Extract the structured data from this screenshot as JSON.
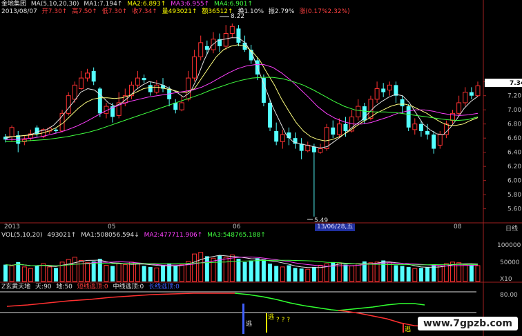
{
  "header": {
    "title": "金地集团",
    "ma_params": "MA(5,10,20,30)",
    "ma1": "MA1:7.194↑",
    "ma2": "MA2:6.893↑",
    "ma3": "MA3:6.955↑",
    "ma4": "MA4:6.901↑",
    "date": "2013/08/07",
    "open": "开7.30↑",
    "high": "高7.50↑",
    "low": "低7.30↑",
    "close": "收7.34↑",
    "volume": "量493021↑",
    "amount": "额36512↑",
    "turnover": "换1.10%",
    "amplitude": "振2.79%",
    "change": "涨(0.17%2.32%)"
  },
  "price_axis": {
    "ticks": [
      "7.40",
      "7.20",
      "7.00",
      "6.80",
      "6.60",
      "6.40",
      "6.20",
      "6.00",
      "5.80",
      "5.60"
    ],
    "current_label": "7.34",
    "high_marker": "8.22",
    "low_marker": "5.49"
  },
  "time_axis": {
    "labels": [
      "2013",
      "05",
      "06",
      "08"
    ],
    "cursor_label": "13/06/28,五",
    "right_label": "日线"
  },
  "volume_pane": {
    "header": "VOL(5,10,20)",
    "vol": "493021↑",
    "ma1": "MA1:508056.594↓",
    "ma2": "MA2:477711.906↑",
    "ma3": "MA3:548765.188↑",
    "ticks": [
      "100000",
      "50000"
    ],
    "unit": "X10"
  },
  "indicator_pane": {
    "header": "Z玄黄天地",
    "tian": "天:90",
    "di": "地:50",
    "short_escape": "短线逃顶:0",
    "mid_escape": "中线逃顶:0",
    "long_escape": "长线逃顶:0",
    "tick": "80.00",
    "signal_escape": "逃",
    "signal_q": "? ? ?"
  },
  "watermark": "www.7gpzb.com",
  "chart_data": {
    "type": "candlestick",
    "ylim": [
      5.45,
      8.3
    ],
    "candles": [
      {
        "o": 6.62,
        "c": 6.58,
        "h": 6.66,
        "l": 6.54
      },
      {
        "o": 6.62,
        "c": 6.75,
        "h": 6.78,
        "l": 6.55
      },
      {
        "o": 6.64,
        "c": 6.52,
        "h": 6.7,
        "l": 6.4
      },
      {
        "o": 6.55,
        "c": 6.58,
        "h": 6.63,
        "l": 6.5
      },
      {
        "o": 6.6,
        "c": 6.66,
        "h": 6.72,
        "l": 6.56
      },
      {
        "o": 6.75,
        "c": 6.66,
        "h": 6.78,
        "l": 6.62
      },
      {
        "o": 6.62,
        "c": 6.72,
        "h": 6.74,
        "l": 6.6
      },
      {
        "o": 6.7,
        "c": 6.74,
        "h": 6.76,
        "l": 6.66
      },
      {
        "o": 6.72,
        "c": 6.7,
        "h": 6.74,
        "l": 6.67
      },
      {
        "o": 6.7,
        "c": 6.95,
        "h": 7.0,
        "l": 6.68
      },
      {
        "o": 6.95,
        "c": 7.2,
        "h": 7.25,
        "l": 6.92
      },
      {
        "o": 7.15,
        "c": 7.35,
        "h": 7.4,
        "l": 7.1
      },
      {
        "o": 7.3,
        "c": 7.45,
        "h": 7.55,
        "l": 7.28
      },
      {
        "o": 7.45,
        "c": 7.52,
        "h": 7.58,
        "l": 7.4
      },
      {
        "o": 7.55,
        "c": 7.4,
        "h": 7.6,
        "l": 7.35
      },
      {
        "o": 7.3,
        "c": 6.95,
        "h": 7.32,
        "l": 6.9
      },
      {
        "o": 6.95,
        "c": 7.05,
        "h": 7.1,
        "l": 6.88
      },
      {
        "o": 7.05,
        "c": 6.9,
        "h": 7.1,
        "l": 6.82
      },
      {
        "o": 6.92,
        "c": 7.1,
        "h": 7.25,
        "l": 6.88
      },
      {
        "o": 7.1,
        "c": 7.2,
        "h": 7.3,
        "l": 7.05
      },
      {
        "o": 7.2,
        "c": 7.35,
        "h": 7.4,
        "l": 7.15
      },
      {
        "o": 7.35,
        "c": 7.45,
        "h": 7.55,
        "l": 7.3
      },
      {
        "o": 7.45,
        "c": 7.42,
        "h": 7.5,
        "l": 7.38
      },
      {
        "o": 7.35,
        "c": 7.25,
        "h": 7.4,
        "l": 7.2
      },
      {
        "o": 7.25,
        "c": 7.35,
        "h": 7.42,
        "l": 7.22
      },
      {
        "o": 7.35,
        "c": 7.3,
        "h": 7.45,
        "l": 7.25
      },
      {
        "o": 7.3,
        "c": 7.15,
        "h": 7.33,
        "l": 7.05
      },
      {
        "o": 7.1,
        "c": 7.0,
        "h": 7.15,
        "l": 6.95
      },
      {
        "o": 7.0,
        "c": 7.1,
        "h": 7.2,
        "l": 6.98
      },
      {
        "o": 7.15,
        "c": 7.45,
        "h": 7.55,
        "l": 7.12
      },
      {
        "o": 7.45,
        "c": 7.75,
        "h": 7.85,
        "l": 7.4
      },
      {
        "o": 7.75,
        "c": 7.95,
        "h": 8.05,
        "l": 7.7
      },
      {
        "o": 7.9,
        "c": 7.85,
        "h": 7.98,
        "l": 7.78
      },
      {
        "o": 7.85,
        "c": 8.0,
        "h": 8.1,
        "l": 7.8
      },
      {
        "o": 8.0,
        "c": 7.9,
        "h": 8.08,
        "l": 7.82
      },
      {
        "o": 7.9,
        "c": 8.08,
        "h": 8.2,
        "l": 7.85
      },
      {
        "o": 8.08,
        "c": 8.18,
        "h": 8.22,
        "l": 8.02
      },
      {
        "o": 8.15,
        "c": 7.95,
        "h": 8.2,
        "l": 7.9
      },
      {
        "o": 7.95,
        "c": 7.85,
        "h": 8.05,
        "l": 7.82
      },
      {
        "o": 7.85,
        "c": 7.7,
        "h": 7.92,
        "l": 7.65
      },
      {
        "o": 7.7,
        "c": 7.5,
        "h": 7.75,
        "l": 7.42
      },
      {
        "o": 7.45,
        "c": 7.1,
        "h": 7.5,
        "l": 7.05
      },
      {
        "o": 7.1,
        "c": 6.75,
        "h": 7.15,
        "l": 6.7
      },
      {
        "o": 6.7,
        "c": 6.55,
        "h": 6.82,
        "l": 6.5
      },
      {
        "o": 6.55,
        "c": 6.65,
        "h": 6.72,
        "l": 6.45
      },
      {
        "o": 6.68,
        "c": 6.6,
        "h": 6.75,
        "l": 6.5
      },
      {
        "o": 6.6,
        "c": 6.52,
        "h": 6.68,
        "l": 6.45
      },
      {
        "o": 6.52,
        "c": 6.42,
        "h": 6.6,
        "l": 6.3
      },
      {
        "o": 6.42,
        "c": 6.5,
        "h": 6.55,
        "l": 6.4
      },
      {
        "o": 6.48,
        "c": 6.4,
        "h": 6.52,
        "l": 5.49
      },
      {
        "o": 6.4,
        "c": 6.45,
        "h": 6.52,
        "l": 6.38
      },
      {
        "o": 6.45,
        "c": 6.75,
        "h": 6.8,
        "l": 6.42
      },
      {
        "o": 6.75,
        "c": 6.65,
        "h": 6.85,
        "l": 6.6
      },
      {
        "o": 6.65,
        "c": 6.8,
        "h": 6.88,
        "l": 6.6
      },
      {
        "o": 6.8,
        "c": 6.7,
        "h": 6.9,
        "l": 6.62
      },
      {
        "o": 6.7,
        "c": 6.9,
        "h": 7.0,
        "l": 6.68
      },
      {
        "o": 6.9,
        "c": 7.05,
        "h": 7.15,
        "l": 6.85
      },
      {
        "o": 7.05,
        "c": 6.85,
        "h": 7.1,
        "l": 6.8
      },
      {
        "o": 6.88,
        "c": 7.15,
        "h": 7.2,
        "l": 6.85
      },
      {
        "o": 7.15,
        "c": 7.3,
        "h": 7.4,
        "l": 7.1
      },
      {
        "o": 7.3,
        "c": 7.25,
        "h": 7.38,
        "l": 7.18
      },
      {
        "o": 7.28,
        "c": 7.35,
        "h": 7.4,
        "l": 7.2
      },
      {
        "o": 7.35,
        "c": 7.2,
        "h": 7.4,
        "l": 7.1
      },
      {
        "o": 7.15,
        "c": 7.05,
        "h": 7.2,
        "l": 6.95
      },
      {
        "o": 7.05,
        "c": 6.75,
        "h": 7.08,
        "l": 6.7
      },
      {
        "o": 6.72,
        "c": 6.8,
        "h": 6.88,
        "l": 6.65
      },
      {
        "o": 6.8,
        "c": 6.7,
        "h": 6.85,
        "l": 6.62
      },
      {
        "o": 6.7,
        "c": 6.65,
        "h": 6.8,
        "l": 6.58
      },
      {
        "o": 6.65,
        "c": 6.45,
        "h": 6.7,
        "l": 6.38
      },
      {
        "o": 6.5,
        "c": 6.65,
        "h": 6.7,
        "l": 6.45
      },
      {
        "o": 6.65,
        "c": 6.8,
        "h": 6.85,
        "l": 6.6
      },
      {
        "o": 6.85,
        "c": 6.95,
        "h": 7.0,
        "l": 6.8
      },
      {
        "o": 6.95,
        "c": 7.1,
        "h": 7.2,
        "l": 6.9
      },
      {
        "o": 7.1,
        "c": 7.25,
        "h": 7.32,
        "l": 7.05
      },
      {
        "o": 7.25,
        "c": 7.2,
        "h": 7.32,
        "l": 7.15
      },
      {
        "o": 7.2,
        "c": 7.34,
        "h": 7.4,
        "l": 7.18
      }
    ],
    "ma_series": [
      {
        "name": "MA1",
        "color": "#e0e0e0",
        "values": [
          6.6,
          6.62,
          6.63,
          6.64,
          6.66,
          6.7,
          6.72,
          6.78,
          6.88,
          7.0,
          7.12,
          7.25,
          7.3,
          7.28,
          7.2,
          7.1,
          7.05,
          7.1,
          7.18,
          7.28,
          7.35,
          7.4,
          7.38,
          7.35,
          7.3,
          7.25,
          7.18,
          7.25,
          7.45,
          7.7,
          7.9,
          7.98,
          8.0,
          8.02,
          8.02,
          7.95,
          7.8,
          7.55,
          7.3,
          7.05,
          6.85,
          6.65,
          6.55,
          6.52,
          6.5,
          6.48,
          6.46,
          6.48,
          6.55,
          6.62,
          6.7,
          6.78,
          6.85,
          6.95,
          7.05,
          7.12,
          7.18,
          7.22,
          7.2,
          7.1,
          6.95,
          6.8,
          6.72,
          6.66,
          6.65,
          6.75,
          6.88,
          7.02,
          7.12,
          7.19
        ]
      },
      {
        "name": "MA2",
        "color": "#ffff80",
        "values": [
          6.62,
          6.62,
          6.63,
          6.64,
          6.65,
          6.67,
          6.7,
          6.75,
          6.82,
          6.92,
          7.02,
          7.1,
          7.15,
          7.17,
          7.17,
          7.16,
          7.17,
          7.2,
          7.25,
          7.3,
          7.32,
          7.32,
          7.3,
          7.28,
          7.25,
          7.25,
          7.3,
          7.45,
          7.6,
          7.75,
          7.85,
          7.9,
          7.92,
          7.9,
          7.82,
          7.7,
          7.52,
          7.35,
          7.15,
          6.98,
          6.82,
          6.7,
          6.62,
          6.58,
          6.56,
          6.58,
          6.62,
          6.68,
          6.75,
          6.82,
          6.88,
          6.95,
          7.0,
          7.05,
          7.08,
          7.08,
          7.05,
          7.0,
          6.95,
          6.88,
          6.82,
          6.78,
          6.78,
          6.8,
          6.85,
          6.89
        ]
      },
      {
        "name": "MA3",
        "color": "#ff40ff",
        "values": [
          6.58,
          6.58,
          6.59,
          6.6,
          6.62,
          6.65,
          6.68,
          6.72,
          6.77,
          6.83,
          6.9,
          6.97,
          7.03,
          7.08,
          7.12,
          7.15,
          7.18,
          7.2,
          7.22,
          7.24,
          7.26,
          7.28,
          7.32,
          7.38,
          7.45,
          7.52,
          7.58,
          7.62,
          7.64,
          7.64,
          7.6,
          7.52,
          7.42,
          7.3,
          7.18,
          7.05,
          6.95,
          6.88,
          6.83,
          6.8,
          6.8,
          6.82,
          6.86,
          6.9,
          6.95,
          6.98,
          7.0,
          7.0,
          6.98,
          6.95,
          6.93,
          6.92,
          6.93,
          6.95
        ]
      },
      {
        "name": "MA4",
        "color": "#40ff40",
        "values": [
          6.55,
          6.55,
          6.56,
          6.57,
          6.58,
          6.6,
          6.62,
          6.65,
          6.68,
          6.72,
          6.77,
          6.82,
          6.87,
          6.92,
          6.97,
          7.02,
          7.07,
          7.12,
          7.17,
          7.22,
          7.28,
          7.33,
          7.38,
          7.42,
          7.45,
          7.46,
          7.46,
          7.44,
          7.4,
          7.35,
          7.28,
          7.2,
          7.12,
          7.05,
          7.0,
          6.98,
          6.97,
          6.97,
          6.96,
          6.94,
          6.92,
          6.9,
          6.88,
          6.86,
          6.85,
          6.86,
          6.9
        ]
      }
    ],
    "volume": [
      52,
      48,
      60,
      45,
      40,
      50,
      55,
      45,
      42,
      60,
      68,
      75,
      65,
      58,
      62,
      70,
      50,
      48,
      55,
      52,
      60,
      55,
      48,
      45,
      42,
      50,
      55,
      48,
      52,
      62,
      85,
      90,
      78,
      72,
      80,
      75,
      82,
      70,
      60,
      65,
      72,
      68,
      55,
      48,
      45,
      50,
      42,
      40,
      38,
      45,
      50,
      55,
      60,
      58,
      52,
      48,
      55,
      62,
      58,
      60,
      65,
      58,
      50,
      48,
      45,
      40,
      42,
      45,
      50,
      48,
      55,
      60,
      58,
      52,
      50,
      49
    ],
    "vol_ylim": [
      0,
      130
    ]
  }
}
